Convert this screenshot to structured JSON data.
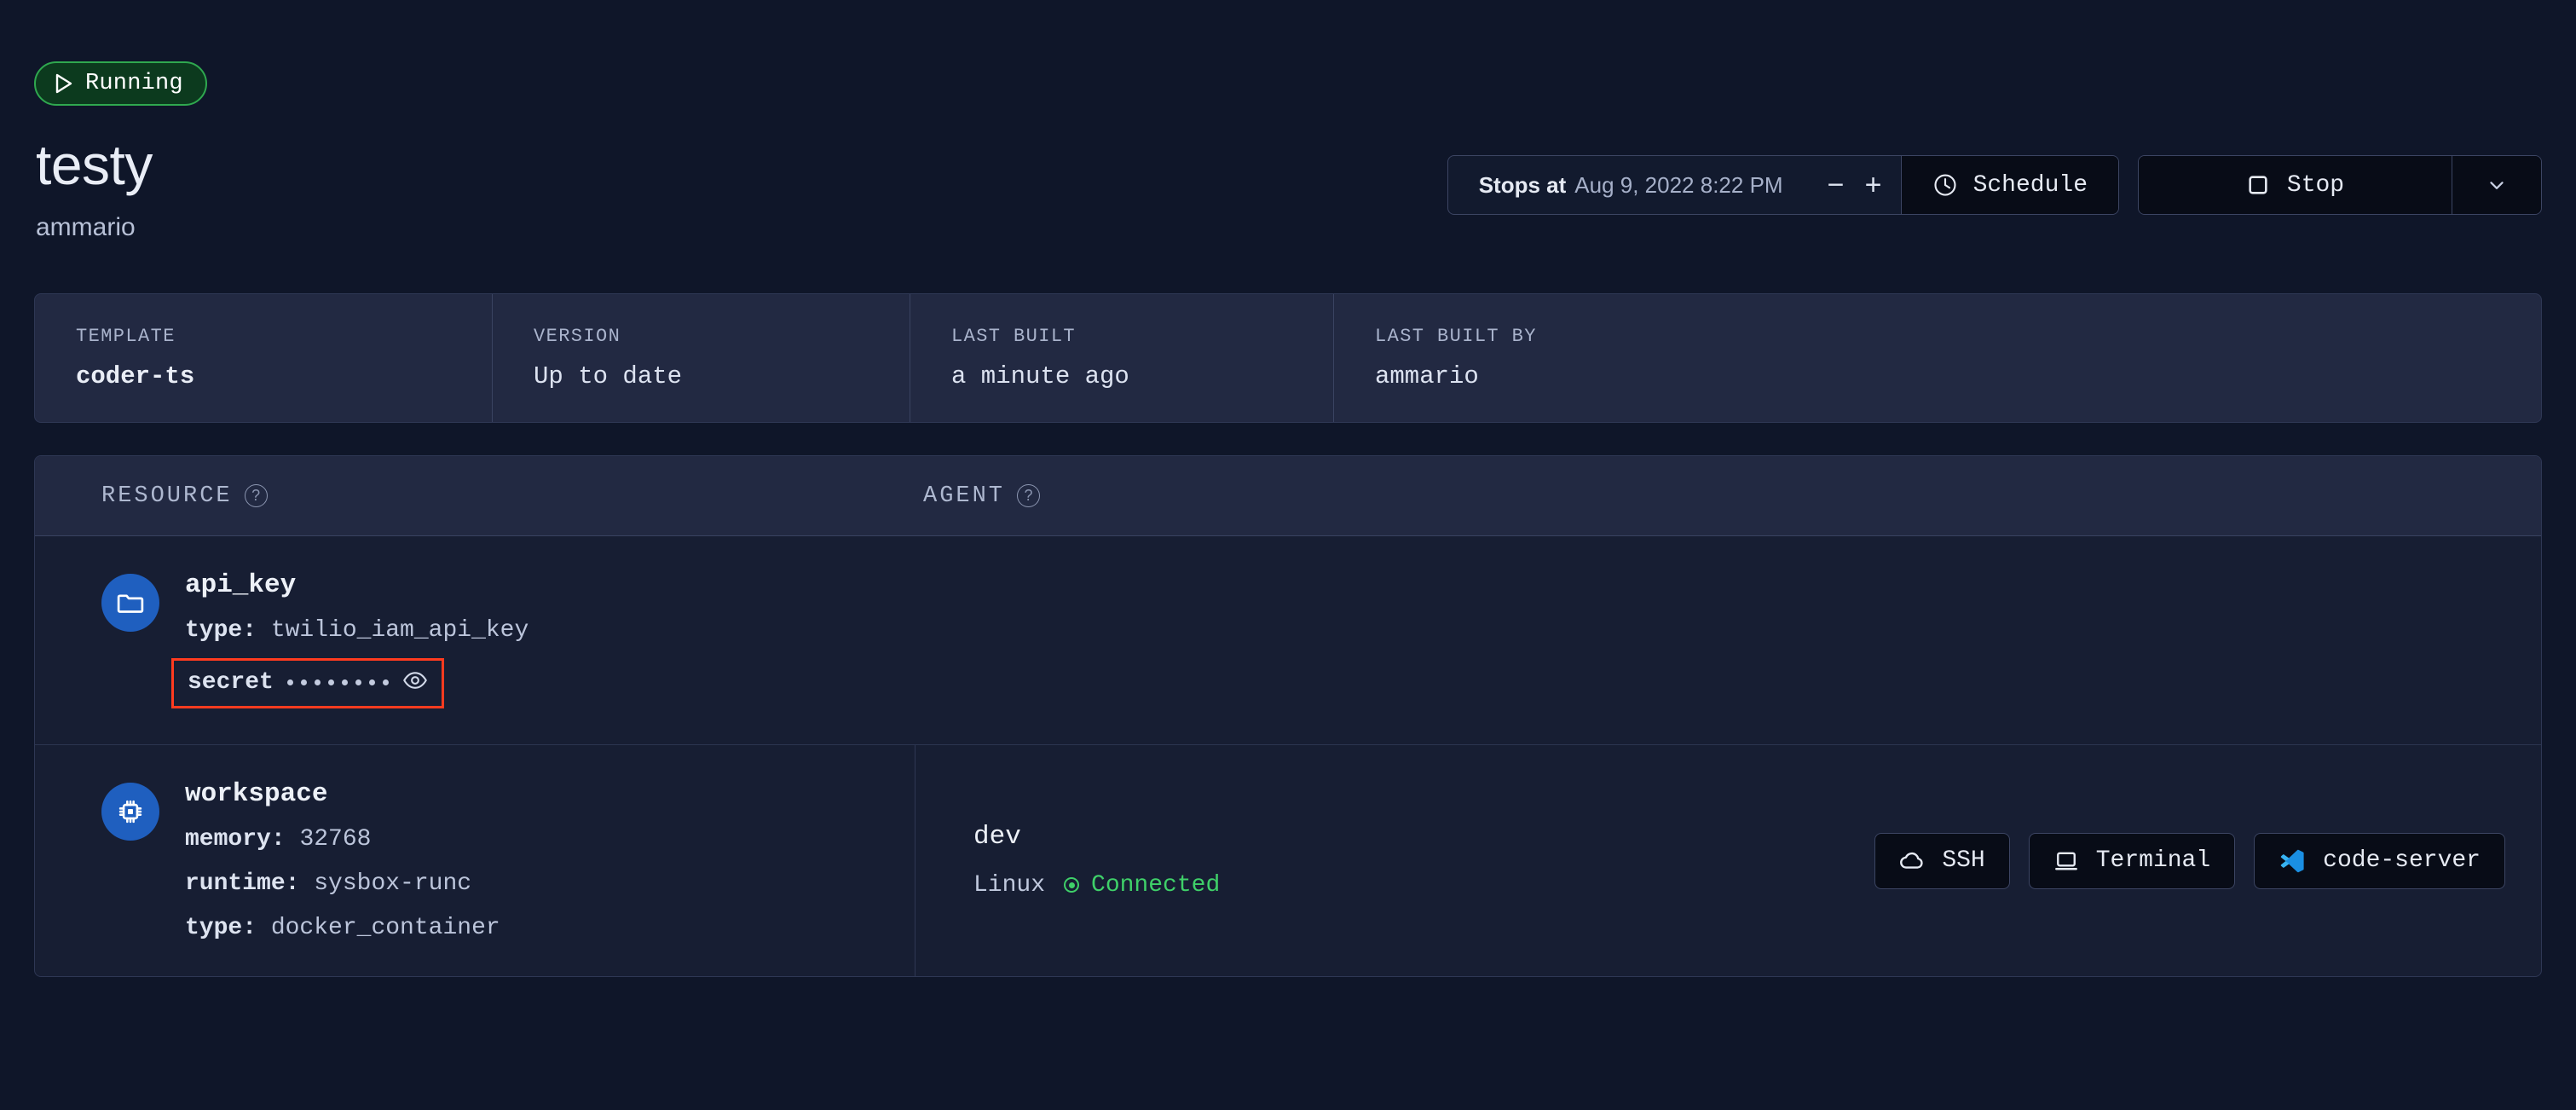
{
  "status": {
    "label": "Running",
    "icon": "play-icon",
    "color": "#2FA84F"
  },
  "workspace": {
    "name": "testy",
    "owner": "ammario"
  },
  "schedule": {
    "prefix": "Stops at",
    "time": "Aug 9, 2022 8:22 PM",
    "decrease_label": "−",
    "increase_label": "+",
    "schedule_button": "Schedule",
    "schedule_icon": "clock-icon"
  },
  "stop": {
    "label": "Stop",
    "icon": "square-stop-icon",
    "dropdown_icon": "chevron-down-icon"
  },
  "stats": [
    {
      "label": "TEMPLATE",
      "value": "coder-ts",
      "bold": true
    },
    {
      "label": "VERSION",
      "value": "Up to date",
      "bold": false
    },
    {
      "label": "LAST BUILT",
      "value": "a minute ago",
      "bold": false
    },
    {
      "label": "LAST BUILT BY",
      "value": "ammario",
      "bold": false
    }
  ],
  "table": {
    "headers": {
      "resource": "RESOURCE",
      "resource_help": "?",
      "agent": "AGENT",
      "agent_help": "?"
    },
    "rows": [
      {
        "resource": {
          "icon": "folder-icon",
          "name": "api_key",
          "attributes": [
            {
              "key": "type:",
              "value": "twilio_iam_api_key"
            }
          ],
          "secret": {
            "label": "secret",
            "masked_value": "••••••••",
            "dot_count": 8,
            "reveal_icon": "eye-icon",
            "highlight_color": "#FF3B1F"
          }
        },
        "agent": null
      },
      {
        "resource": {
          "icon": "cpu-chip-icon",
          "name": "workspace",
          "attributes": [
            {
              "key": "memory:",
              "value": "32768"
            },
            {
              "key": "runtime:",
              "value": "sysbox-runc"
            },
            {
              "key": "type:",
              "value": "docker_container"
            }
          ],
          "secret": null
        },
        "agent": {
          "name": "dev",
          "os": "Linux",
          "status": "Connected",
          "status_color": "#3FD069",
          "status_icon": "connected-dot-icon",
          "buttons": [
            {
              "label": "SSH",
              "icon": "cloud-icon"
            },
            {
              "label": "Terminal",
              "icon": "terminal-monitor-icon"
            },
            {
              "label": "code-server",
              "icon": "vscode-icon"
            }
          ]
        }
      }
    ]
  }
}
